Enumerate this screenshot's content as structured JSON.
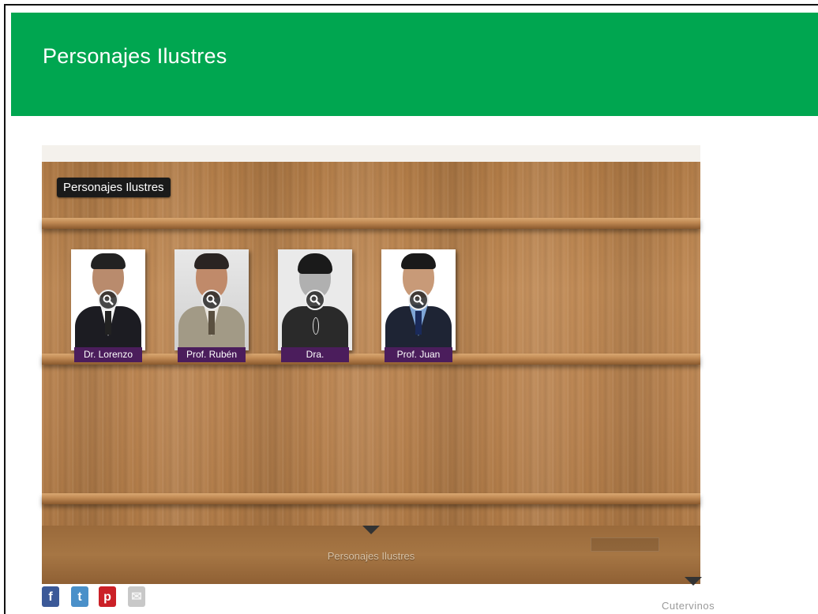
{
  "header": {
    "title": "Personajes Ilustres"
  },
  "shelf": {
    "title": "Personajes Ilustres",
    "items": [
      {
        "label": "Dr. Lorenzo",
        "icon": "zoom-icon"
      },
      {
        "label": "Prof. Rubén",
        "icon": "zoom-icon"
      },
      {
        "label": "Dra.",
        "icon": "zoom-icon"
      },
      {
        "label": "Prof. Juan",
        "icon": "zoom-icon"
      }
    ],
    "footer_caption": "Personajes Ilustres"
  },
  "social": [
    {
      "name": "facebook-icon",
      "glyph": "f",
      "color": "#3b5998"
    },
    {
      "name": "twitter-icon",
      "glyph": "t",
      "color": "#4a90c9"
    },
    {
      "name": "pinterest-icon",
      "glyph": "p",
      "color": "#cb2027"
    },
    {
      "name": "email-icon",
      "glyph": "✉",
      "color": "#c8c8c8"
    }
  ],
  "credit": "Cutervinos",
  "colors": {
    "header": "#00a650",
    "label_bg": "#4b1d5c"
  }
}
